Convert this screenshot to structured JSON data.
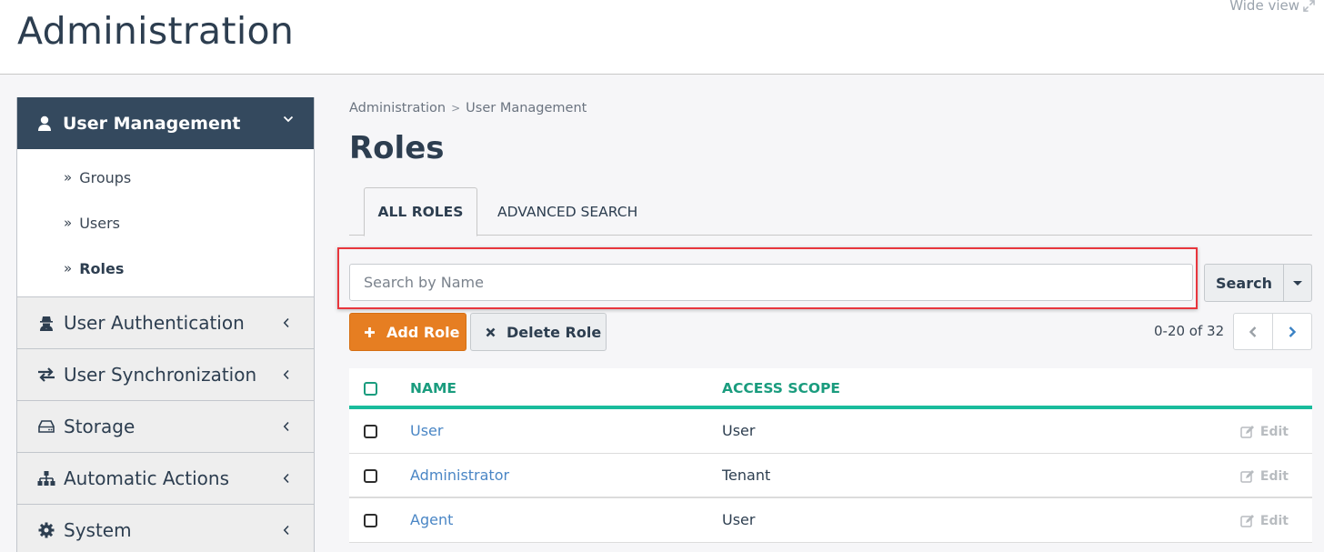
{
  "header": {
    "title": "Administration",
    "wide_view_label": "Wide view",
    "wide_view_icon": "expand-icon"
  },
  "sidebar": {
    "section": {
      "label": "User Management",
      "icon": "user-icon",
      "expanded": true,
      "items": [
        {
          "label": "Groups",
          "active": false
        },
        {
          "label": "Users",
          "active": false
        },
        {
          "label": "Roles",
          "active": true
        }
      ]
    },
    "items": [
      {
        "label": "User Authentication",
        "icon": "user-secret-icon"
      },
      {
        "label": "User Synchronization",
        "icon": "exchange-icon"
      },
      {
        "label": "Storage",
        "icon": "hdd-icon"
      },
      {
        "label": "Automatic Actions",
        "icon": "sitemap-icon"
      },
      {
        "label": "System",
        "icon": "gear-icon"
      }
    ]
  },
  "breadcrumb": [
    "Administration",
    "User Management"
  ],
  "page": {
    "title": "Roles"
  },
  "tabs": [
    {
      "label": "ALL ROLES",
      "active": true
    },
    {
      "label": "ADVANCED SEARCH",
      "active": false
    }
  ],
  "search": {
    "placeholder": "Search by Name",
    "value": "",
    "button_label": "Search"
  },
  "actions": {
    "add_label": "Add Role",
    "delete_label": "Delete Role"
  },
  "pagination": {
    "text": "0-20 of 32"
  },
  "table": {
    "columns": [
      "NAME",
      "ACCESS SCOPE"
    ],
    "edit_label": "Edit",
    "rows": [
      {
        "name": "User",
        "scope": "User"
      },
      {
        "name": "Administrator",
        "scope": "Tenant"
      },
      {
        "name": "Agent",
        "scope": "User"
      }
    ]
  },
  "colors": {
    "sidebar_active": "#34495e",
    "accent_orange": "#e67e22",
    "table_accent": "#1abc9c",
    "link": "#4a86c5",
    "highlight": "#e8363d"
  }
}
